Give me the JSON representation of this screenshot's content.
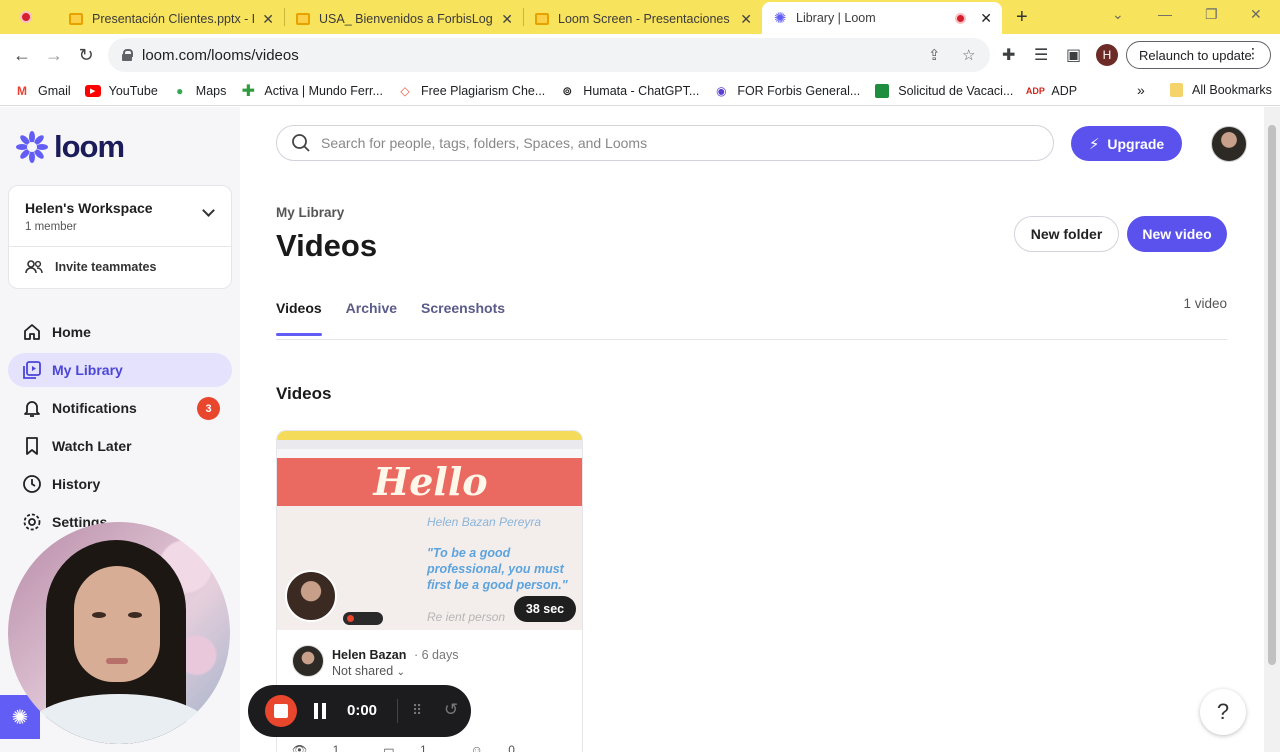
{
  "browser": {
    "tabs": [
      {
        "title": "Presentación Clientes.pptx - Pre",
        "icon": "slides-icon",
        "active": false
      },
      {
        "title": "USA_ Bienvenidos a ForbisLogist",
        "icon": "slides-icon",
        "active": false
      },
      {
        "title": "Loom Screen - Presentaciones d",
        "icon": "slides-icon",
        "active": false
      },
      {
        "title": "Library | Loom",
        "icon": "loom-icon",
        "active": true
      }
    ],
    "url": "loom.com/looms/videos",
    "profile_initial": "H",
    "relaunch_label": "Relaunch to update",
    "bookmarks": [
      {
        "label": "Gmail",
        "icon": "gmail-icon",
        "color": "#ea4335"
      },
      {
        "label": "YouTube",
        "icon": "youtube-icon",
        "color": "#ff0000"
      },
      {
        "label": "Maps",
        "icon": "maps-icon",
        "color": "#34a853"
      },
      {
        "label": "Activa | Mundo Ferr...",
        "icon": "plus-cross-icon",
        "color": "#2e9b3d"
      },
      {
        "label": "Free Plagiarism Che...",
        "icon": "plagiarism-icon",
        "color": "#e2573d"
      },
      {
        "label": "Humata - ChatGPT...",
        "icon": "humata-icon",
        "color": "#222222"
      },
      {
        "label": "FOR Forbis General...",
        "icon": "forbis-icon",
        "color": "#5b3fd1"
      },
      {
        "label": "Solicitud de Vacaci...",
        "icon": "sheets-icon",
        "color": "#1e8e3e"
      },
      {
        "label": "ADP",
        "icon": "adp-icon",
        "color": "#d0271d"
      }
    ],
    "more_bookmarks": "»",
    "all_bookmarks": "All Bookmarks"
  },
  "sidebar": {
    "logo_text": "loom",
    "workspace": {
      "name": "Helen's Workspace",
      "members": "1 member"
    },
    "invite_label": "Invite teammates",
    "nav": [
      {
        "label": "Home",
        "icon": "home-icon",
        "active": false
      },
      {
        "label": "My Library",
        "icon": "library-icon",
        "active": true
      },
      {
        "label": "Notifications",
        "icon": "bell-icon",
        "active": false,
        "badge": "3"
      },
      {
        "label": "Watch Later",
        "icon": "bookmark-icon",
        "active": false
      },
      {
        "label": "History",
        "icon": "clock-icon",
        "active": false
      },
      {
        "label": "Settings",
        "icon": "gear-icon",
        "active": false
      }
    ]
  },
  "header": {
    "search_placeholder": "Search for people, tags, folders, Spaces, and Looms",
    "upgrade_label": "Upgrade"
  },
  "main": {
    "breadcrumb": "My Library",
    "title": "Videos",
    "new_folder_label": "New folder",
    "new_video_label": "New video",
    "tabs": [
      {
        "label": "Videos",
        "active": true
      },
      {
        "label": "Archive",
        "active": false
      },
      {
        "label": "Screenshots",
        "active": false
      }
    ],
    "video_count": "1 video",
    "section_title": "Videos",
    "video": {
      "thumb_heading": "Hello",
      "thumb_name": "Helen Bazan Pereyra",
      "thumb_quote": "\"To be a good professional, you must first be a good person.\"",
      "thumb_footer": "Re ient person",
      "duration": "38 sec",
      "author": "Helen Bazan",
      "age": "· 6 days",
      "sharing": "Not shared",
      "stats": {
        "views": "1",
        "comments": "1",
        "reactions": "0"
      }
    }
  },
  "recorder": {
    "time": "0:00"
  },
  "help_label": "?",
  "colors": {
    "accent": "#625df5",
    "badge": "#e8462d",
    "tabbar": "#f7e35c"
  }
}
